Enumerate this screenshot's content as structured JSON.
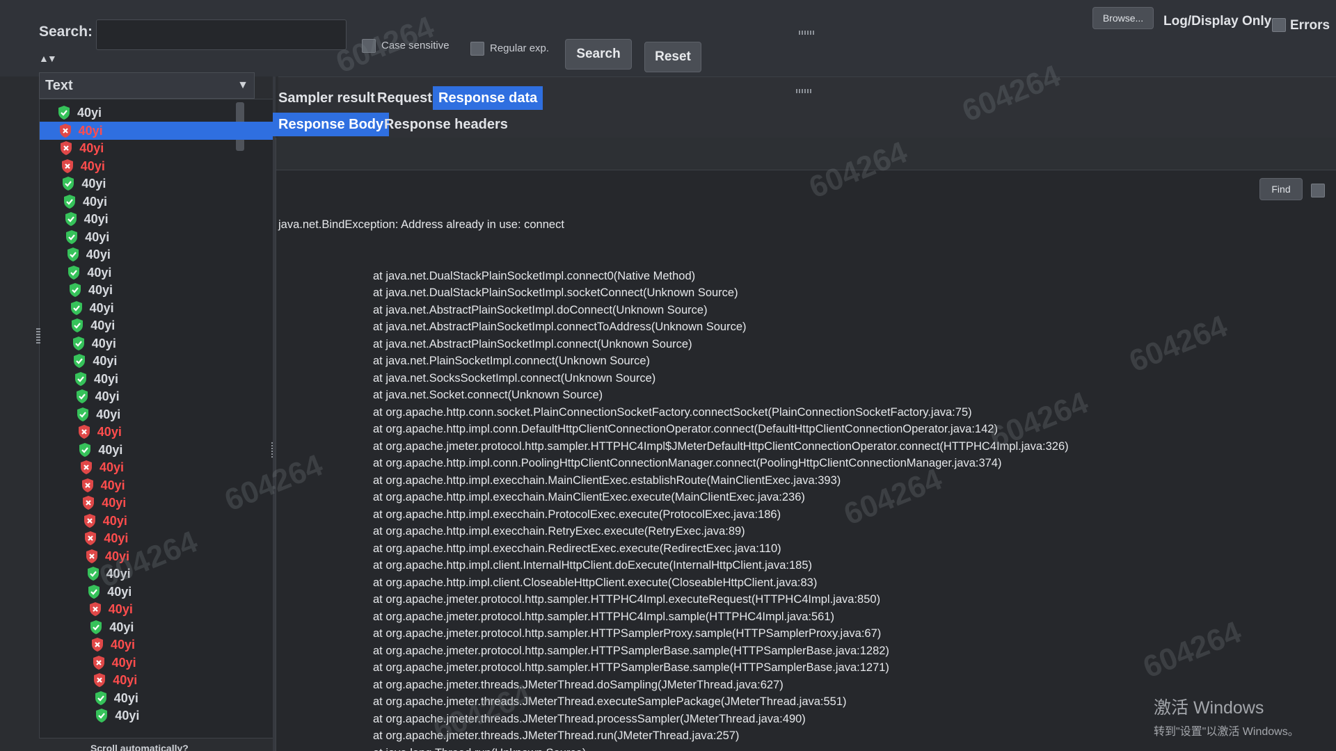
{
  "toolbar": {
    "search_label": "Search:",
    "search_value": "",
    "case_sensitive_label": "Case sensitive",
    "regular_exp_label": "Regular exp.",
    "search_button": "Search",
    "reset_button": "Reset",
    "browse_button": "Browse...",
    "log_display_label": "Log/Display Only:",
    "errors_label": "Errors"
  },
  "left_panel": {
    "sort_arrows": "▲▼",
    "column_header": "Text",
    "scroll_auto_label": "Scroll automatically?",
    "items": [
      {
        "label": "40yi",
        "status": "ok"
      },
      {
        "label": "40yi",
        "status": "error",
        "selected": true
      },
      {
        "label": "40yi",
        "status": "error"
      },
      {
        "label": "40yi",
        "status": "error"
      },
      {
        "label": "40yi",
        "status": "ok"
      },
      {
        "label": "40yi",
        "status": "ok"
      },
      {
        "label": "40yi",
        "status": "ok"
      },
      {
        "label": "40yi",
        "status": "ok"
      },
      {
        "label": "40yi",
        "status": "ok"
      },
      {
        "label": "40yi",
        "status": "ok"
      },
      {
        "label": "40yi",
        "status": "ok"
      },
      {
        "label": "40yi",
        "status": "ok"
      },
      {
        "label": "40yi",
        "status": "ok"
      },
      {
        "label": "40yi",
        "status": "ok"
      },
      {
        "label": "40yi",
        "status": "ok"
      },
      {
        "label": "40yi",
        "status": "ok"
      },
      {
        "label": "40yi",
        "status": "ok"
      },
      {
        "label": "40yi",
        "status": "ok"
      },
      {
        "label": "40yi",
        "status": "error"
      },
      {
        "label": "40yi",
        "status": "ok"
      },
      {
        "label": "40yi",
        "status": "error"
      },
      {
        "label": "40yi",
        "status": "error"
      },
      {
        "label": "40yi",
        "status": "error"
      },
      {
        "label": "40yi",
        "status": "error"
      },
      {
        "label": "40yi",
        "status": "error"
      },
      {
        "label": "40yi",
        "status": "error"
      },
      {
        "label": "40yi",
        "status": "ok"
      },
      {
        "label": "40yi",
        "status": "ok"
      },
      {
        "label": "40yi",
        "status": "error"
      },
      {
        "label": "40yi",
        "status": "ok"
      },
      {
        "label": "40yi",
        "status": "error"
      },
      {
        "label": "40yi",
        "status": "error"
      },
      {
        "label": "40yi",
        "status": "error"
      },
      {
        "label": "40yi",
        "status": "ok"
      },
      {
        "label": "40yi",
        "status": "ok"
      }
    ]
  },
  "tabs": [
    {
      "label": "Sampler result",
      "active": false
    },
    {
      "label": "Request",
      "active": false
    },
    {
      "label": "Response data",
      "active": true
    }
  ],
  "subtabs": [
    {
      "label": "Response Body",
      "active": true
    },
    {
      "label": "Response headers",
      "active": false
    }
  ],
  "find": {
    "button_label": "Find"
  },
  "response_body": {
    "first_line": "java.net.BindException: Address already in use: connect",
    "stack": [
      "at java.net.DualStackPlainSocketImpl.connect0(Native Method)",
      "at java.net.DualStackPlainSocketImpl.socketConnect(Unknown Source)",
      "at java.net.AbstractPlainSocketImpl.doConnect(Unknown Source)",
      "at java.net.AbstractPlainSocketImpl.connectToAddress(Unknown Source)",
      "at java.net.AbstractPlainSocketImpl.connect(Unknown Source)",
      "at java.net.PlainSocketImpl.connect(Unknown Source)",
      "at java.net.SocksSocketImpl.connect(Unknown Source)",
      "at java.net.Socket.connect(Unknown Source)",
      "at org.apache.http.conn.socket.PlainConnectionSocketFactory.connectSocket(PlainConnectionSocketFactory.java:75)",
      "at org.apache.http.impl.conn.DefaultHttpClientConnectionOperator.connect(DefaultHttpClientConnectionOperator.java:142)",
      "at org.apache.jmeter.protocol.http.sampler.HTTPHC4Impl$JMeterDefaultHttpClientConnectionOperator.connect(HTTPHC4Impl.java:326)",
      "at org.apache.http.impl.conn.PoolingHttpClientConnectionManager.connect(PoolingHttpClientConnectionManager.java:374)",
      "at org.apache.http.impl.execchain.MainClientExec.establishRoute(MainClientExec.java:393)",
      "at org.apache.http.impl.execchain.MainClientExec.execute(MainClientExec.java:236)",
      "at org.apache.http.impl.execchain.ProtocolExec.execute(ProtocolExec.java:186)",
      "at org.apache.http.impl.execchain.RetryExec.execute(RetryExec.java:89)",
      "at org.apache.http.impl.execchain.RedirectExec.execute(RedirectExec.java:110)",
      "at org.apache.http.impl.client.InternalHttpClient.doExecute(InternalHttpClient.java:185)",
      "at org.apache.http.impl.client.CloseableHttpClient.execute(CloseableHttpClient.java:83)",
      "at org.apache.jmeter.protocol.http.sampler.HTTPHC4Impl.executeRequest(HTTPHC4Impl.java:850)",
      "at org.apache.jmeter.protocol.http.sampler.HTTPHC4Impl.sample(HTTPHC4Impl.java:561)",
      "at org.apache.jmeter.protocol.http.sampler.HTTPSamplerProxy.sample(HTTPSamplerProxy.java:67)",
      "at org.apache.jmeter.protocol.http.sampler.HTTPSamplerBase.sample(HTTPSamplerBase.java:1282)",
      "at org.apache.jmeter.protocol.http.sampler.HTTPSamplerBase.sample(HTTPSamplerBase.java:1271)",
      "at org.apache.jmeter.threads.JMeterThread.doSampling(JMeterThread.java:627)",
      "at org.apache.jmeter.threads.JMeterThread.executeSamplePackage(JMeterThread.java:551)",
      "at org.apache.jmeter.threads.JMeterThread.processSampler(JMeterThread.java:490)",
      "at org.apache.jmeter.threads.JMeterThread.run(JMeterThread.java:257)",
      "at java.lang.Thread.run(Unknown Source)"
    ]
  },
  "watermark_text": "604264",
  "activation": {
    "title": "激活 Windows",
    "subtitle": "转到\"设置\"以激活 Windows。"
  },
  "colors": {
    "accent": "#2f6fe0",
    "ok_icon": "#36c25a",
    "error_icon": "#e04848",
    "error_text": "#ff4d4d"
  }
}
